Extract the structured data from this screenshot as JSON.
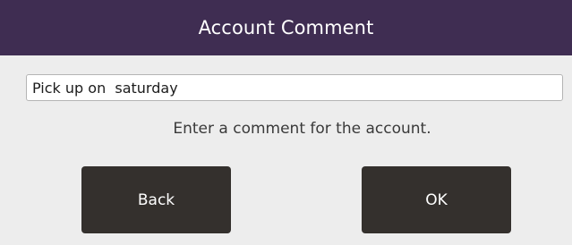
{
  "dialog": {
    "title": "Account Comment",
    "comment": {
      "value": "Pick up on  saturday"
    },
    "instruction": "Enter a comment for the account.",
    "buttons": {
      "back_label": "Back",
      "ok_label": "OK"
    }
  },
  "colors": {
    "title_bar": "#3f2d52",
    "background": "#ededed",
    "button": "#34302d"
  }
}
